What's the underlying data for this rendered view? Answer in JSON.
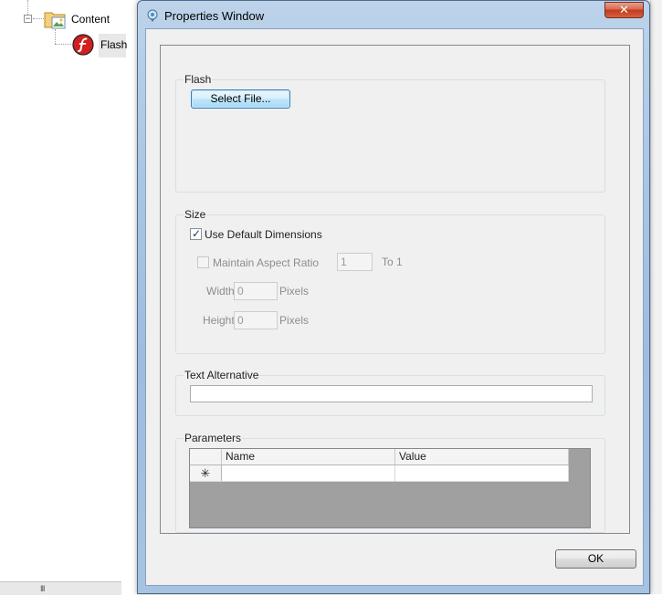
{
  "tree": {
    "items": [
      {
        "label": "Content"
      },
      {
        "label": "Flash"
      }
    ]
  },
  "window": {
    "title": "Properties Window",
    "close_glyph": "✕",
    "app_icon": "balloon-icon"
  },
  "flash_group": {
    "title": "Flash",
    "select_file_label": "Select File..."
  },
  "size_group": {
    "title": "Size",
    "use_default_dimensions_label": "Use Default Dimensions",
    "use_default_dimensions_checked": true,
    "maintain_aspect_ratio_label": "Maintain Aspect Ratio",
    "maintain_aspect_ratio_checked": false,
    "aspect_value": "1",
    "to_one_label": "To 1",
    "width_label": "Width",
    "width_value": "0",
    "width_unit": "Pixels",
    "height_label": "Height",
    "height_value": "0",
    "height_unit": "Pixels"
  },
  "text_alternative_group": {
    "title": "Text Alternative",
    "value": ""
  },
  "parameters_group": {
    "title": "Parameters",
    "columns": [
      "Name",
      "Value"
    ],
    "new_row_glyph": "✳"
  },
  "footer": {
    "ok_label": "OK"
  },
  "scroll_grip": "III"
}
